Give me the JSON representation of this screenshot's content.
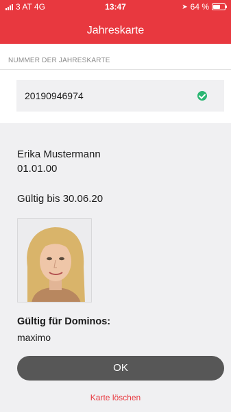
{
  "status": {
    "carrier": "3 AT 4G",
    "time": "13:47",
    "battery": "64 %",
    "battery_level": 0.64
  },
  "header": {
    "title": "Jahreskarte"
  },
  "form": {
    "number_label": "NUMMER DER JAHRESKARTE",
    "number_value": "20190946974"
  },
  "card": {
    "name": "Erika Mustermann",
    "birthdate": "01.01.00",
    "valid_until": "Gültig bis 30.06.20",
    "valid_for_heading": "Gültig für Dominos:",
    "valid_for_value": "maximo"
  },
  "actions": {
    "ok_label": "OK",
    "delete_label": "Karte löschen"
  },
  "colors": {
    "brand_red": "#e8383f",
    "success_green": "#2bb673",
    "button_gray": "#575757"
  }
}
